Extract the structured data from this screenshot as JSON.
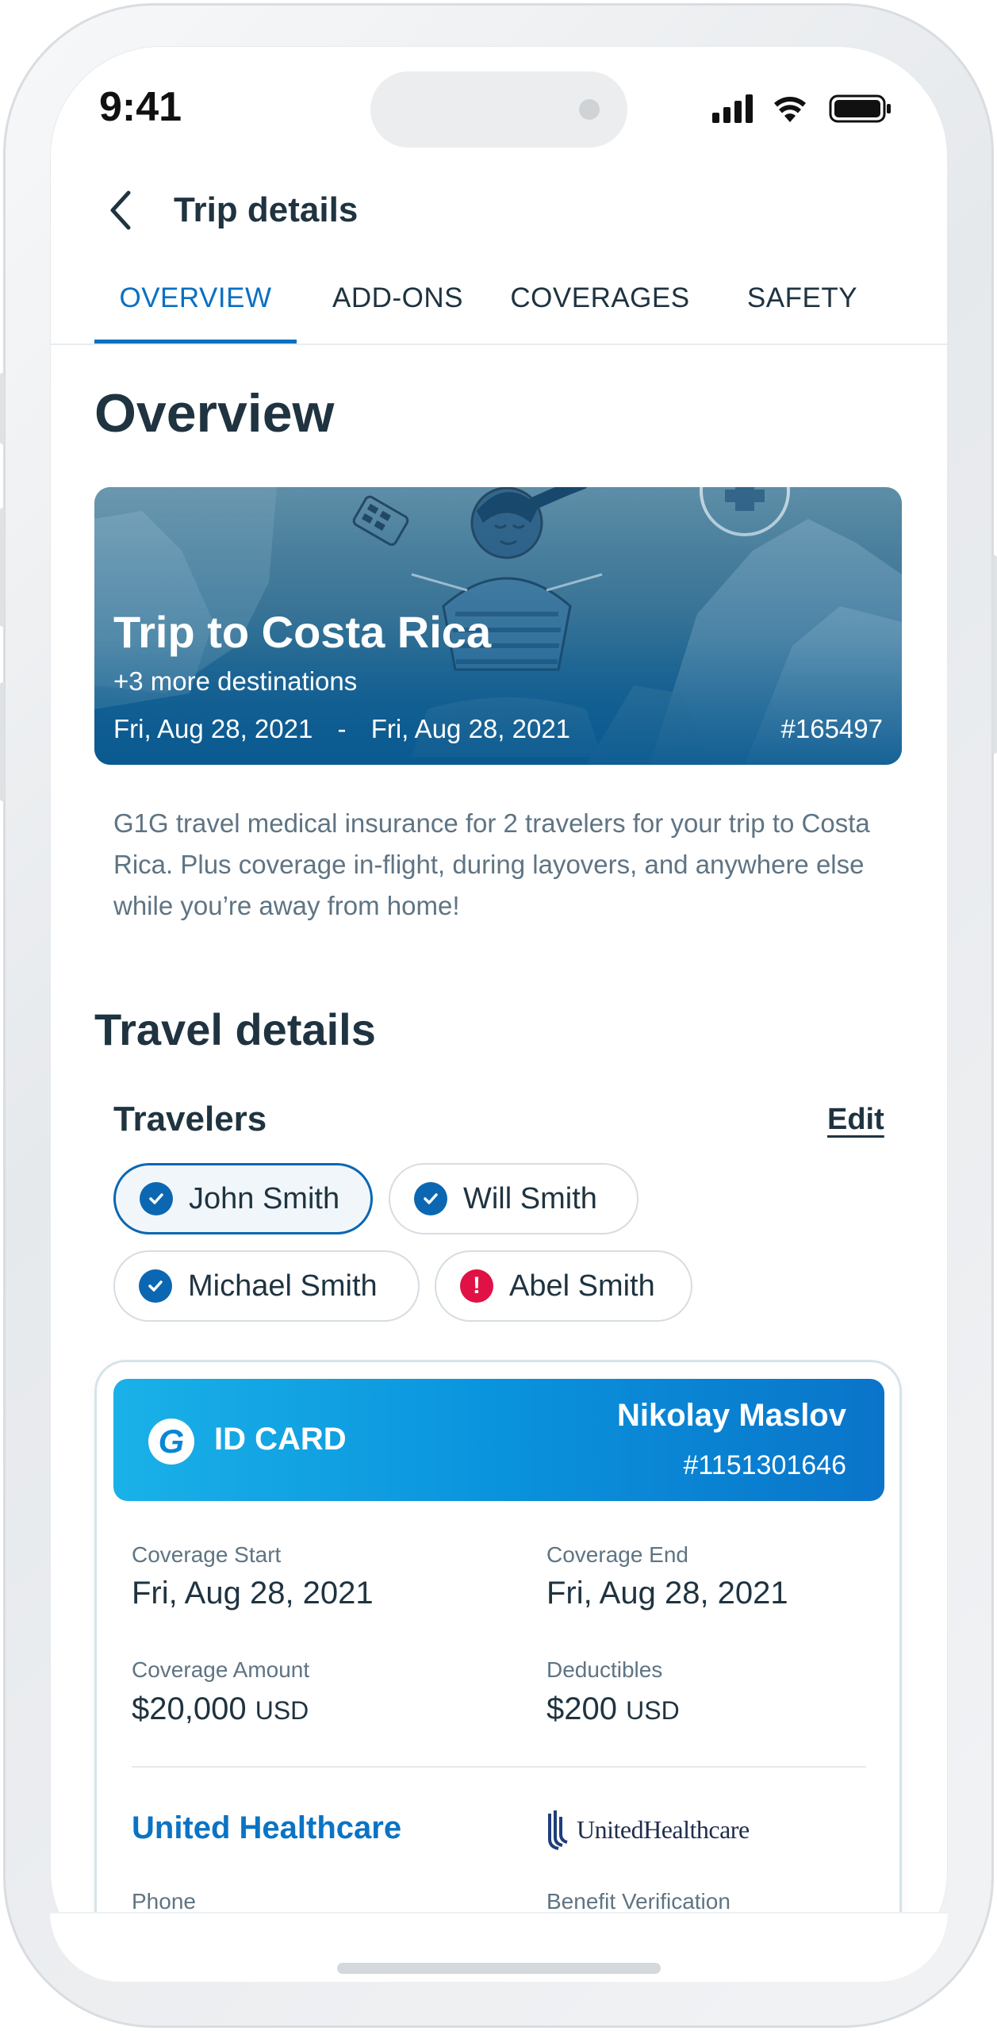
{
  "status_bar": {
    "time": "9:41"
  },
  "header": {
    "title": "Trip details"
  },
  "tabs": [
    {
      "label": "OVERVIEW",
      "active": true
    },
    {
      "label": "ADD-ONS",
      "active": false
    },
    {
      "label": "COVERAGES",
      "active": false
    },
    {
      "label": "SAFETY",
      "active": false
    }
  ],
  "overview": {
    "title": "Overview",
    "trip": {
      "title": "Trip to Costa Rica",
      "subtitle": "+3 more destinations",
      "start_date": "Fri, Aug 28, 2021",
      "separator": "-",
      "end_date": "Fri, Aug 28, 2021",
      "number": "#165497"
    },
    "description": "G1G travel medical insurance for 2 travelers for your trip to Costa Rica. Plus coverage in-flight, during layovers, and anywhere else while you’re away from home!"
  },
  "travel_details": {
    "title": "Travel details",
    "travelers_title": "Travelers",
    "edit_label": "Edit",
    "travelers": [
      {
        "name": "John Smith",
        "status": "check",
        "selected": true
      },
      {
        "name": "Will Smith",
        "status": "check",
        "selected": false
      },
      {
        "name": "Michael Smith",
        "status": "check",
        "selected": false
      },
      {
        "name": "Abel Smith",
        "status": "warning",
        "selected": false
      }
    ]
  },
  "id_card": {
    "logo_letter": "G",
    "label": "ID CARD",
    "holder_name": "Nikolay Maslov",
    "holder_number": "#1151301646",
    "coverage_start_label": "Coverage Start",
    "coverage_start_value": "Fri, Aug 28, 2021",
    "coverage_end_label": "Coverage End",
    "coverage_end_value": "Fri, Aug 28, 2021",
    "coverage_amount_label": "Coverage Amount",
    "coverage_amount_value": "$20,000",
    "coverage_amount_unit": "USD",
    "deductibles_label": "Deductibles",
    "deductibles_value": "$200",
    "deductibles_unit": "USD",
    "provider_name": "United Healthcare",
    "provider_logo_text": "UnitedHealthcare",
    "phone_label": "Phone",
    "benefit_label": "Benefit Verification"
  },
  "colors": {
    "accent": "#0a6fc2",
    "text_primary": "#1f3340",
    "text_secondary": "#5f7483",
    "warning": "#e01144",
    "card_gradient_start": "#1ab1e8",
    "card_gradient_end": "#0a74c9"
  }
}
